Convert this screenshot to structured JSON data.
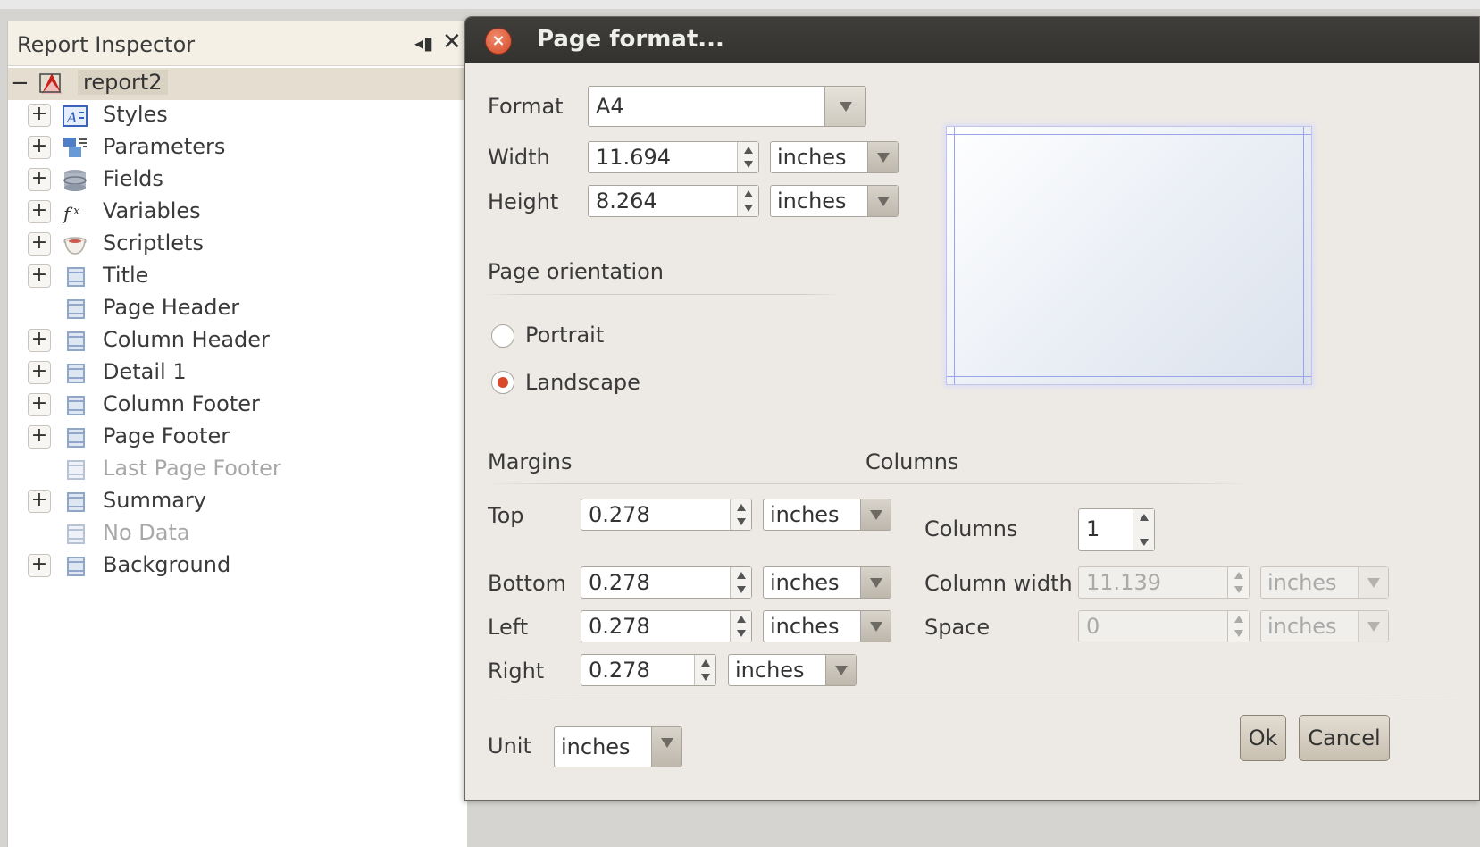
{
  "inspector": {
    "title": "Report Inspector",
    "min_glyph": "◂▮",
    "close_glyph": "✕",
    "root": {
      "collapse": "−",
      "label": "report2",
      "icon": "report-icon"
    },
    "items": [
      {
        "label": "Styles",
        "icon": "styles-icon",
        "expandable": true,
        "dim": false
      },
      {
        "label": "Parameters",
        "icon": "parameters-icon",
        "expandable": true,
        "dim": false
      },
      {
        "label": "Fields",
        "icon": "fields-icon",
        "expandable": true,
        "dim": false
      },
      {
        "label": "Variables",
        "icon": "variables-icon",
        "expandable": true,
        "dim": false
      },
      {
        "label": "Scriptlets",
        "icon": "scriptlets-icon",
        "expandable": true,
        "dim": false
      },
      {
        "label": "Title",
        "icon": "band-icon",
        "expandable": true,
        "dim": false
      },
      {
        "label": "Page Header",
        "icon": "band-icon",
        "expandable": false,
        "dim": false
      },
      {
        "label": "Column Header",
        "icon": "band-icon",
        "expandable": true,
        "dim": false
      },
      {
        "label": "Detail 1",
        "icon": "band-icon",
        "expandable": true,
        "dim": false
      },
      {
        "label": "Column Footer",
        "icon": "band-icon",
        "expandable": true,
        "dim": false
      },
      {
        "label": "Page Footer",
        "icon": "band-icon",
        "expandable": true,
        "dim": false
      },
      {
        "label": "Last Page Footer",
        "icon": "band-icon",
        "expandable": false,
        "dim": true
      },
      {
        "label": "Summary",
        "icon": "band-icon",
        "expandable": true,
        "dim": false
      },
      {
        "label": "No Data",
        "icon": "band-icon",
        "expandable": false,
        "dim": true
      },
      {
        "label": "Background",
        "icon": "band-icon",
        "expandable": true,
        "dim": false
      }
    ]
  },
  "dialog": {
    "title": "Page format...",
    "close_glyph": "×",
    "format": {
      "label": "Format",
      "value": "A4"
    },
    "width": {
      "label": "Width",
      "value": "11.694",
      "unit": "inches"
    },
    "height": {
      "label": "Height",
      "value": "8.264",
      "unit": "inches"
    },
    "orientation": {
      "section": "Page orientation",
      "portrait": "Portrait",
      "landscape": "Landscape",
      "selected": "Landscape"
    },
    "margins": {
      "section": "Margins",
      "top": {
        "label": "Top",
        "value": "0.278",
        "unit": "inches"
      },
      "bottom": {
        "label": "Bottom",
        "value": "0.278",
        "unit": "inches"
      },
      "left": {
        "label": "Left",
        "value": "0.278",
        "unit": "inches"
      },
      "right": {
        "label": "Right",
        "value": "0.278",
        "unit": "inches"
      }
    },
    "columns": {
      "section": "Columns",
      "count": {
        "label": "Columns",
        "value": "1"
      },
      "width": {
        "label": "Column width",
        "value": "11.139",
        "unit": "inches"
      },
      "space": {
        "label": "Space",
        "value": "0",
        "unit": "inches"
      }
    },
    "unit": {
      "label": "Unit",
      "value": "inches"
    },
    "ok": "Ok",
    "cancel": "Cancel"
  },
  "colors": {
    "accent": "#d9482a",
    "preview_margin": "#9aa4ea",
    "titlebar": "#3a3936"
  }
}
